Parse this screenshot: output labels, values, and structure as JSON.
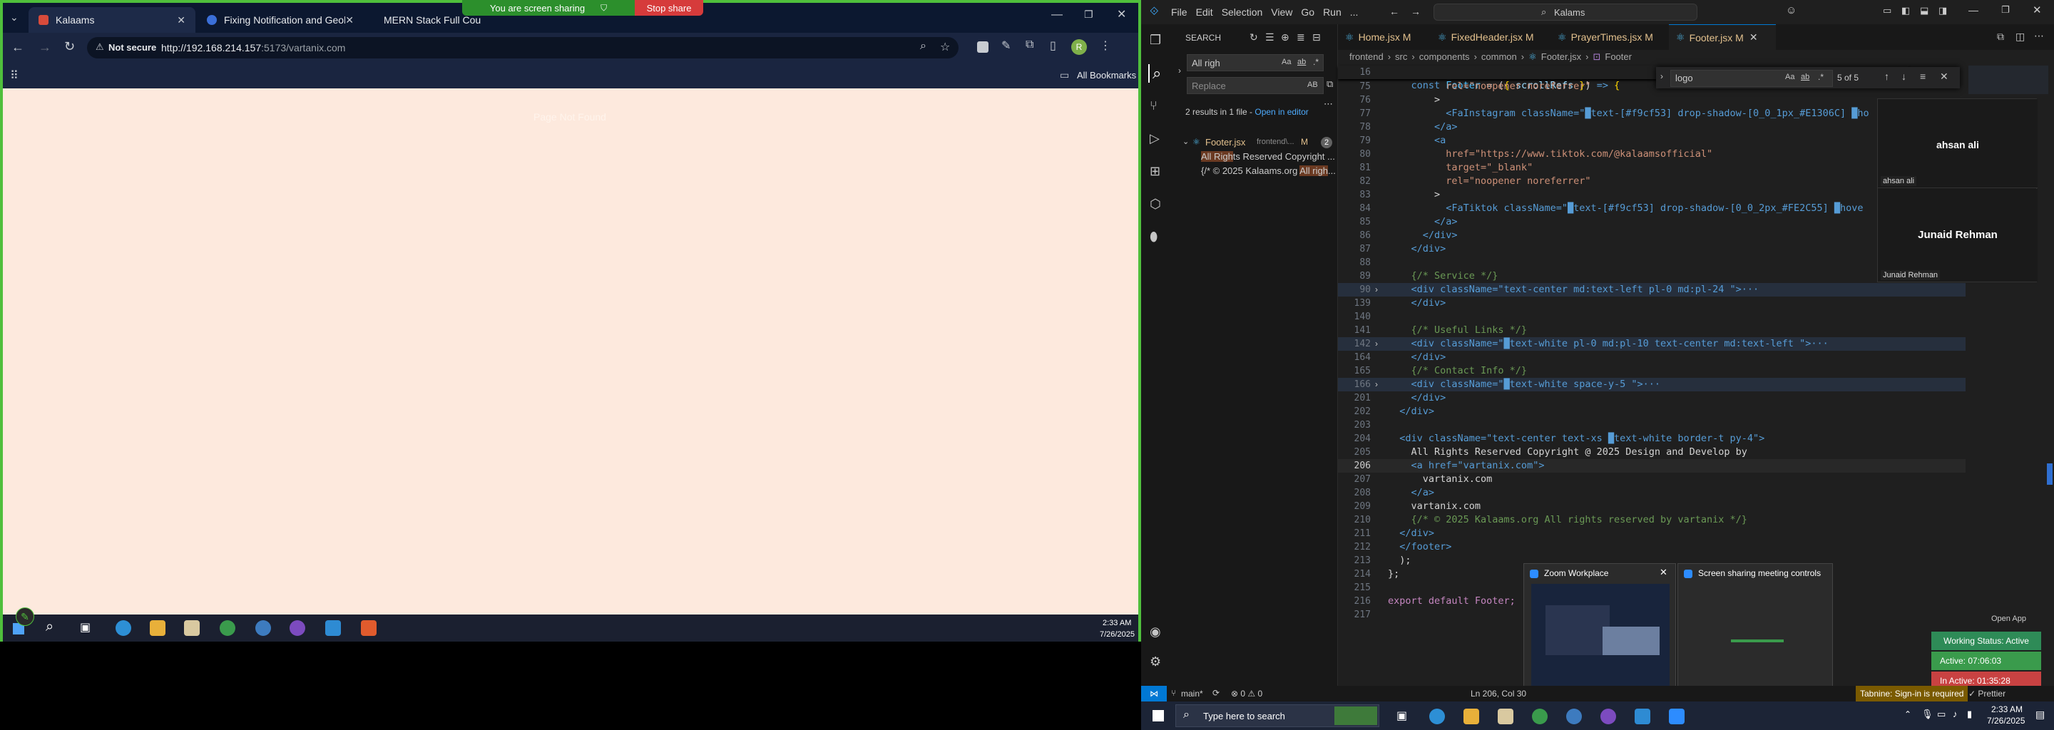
{
  "share": {
    "banner_text": "You are screen sharing",
    "stop_label": "Stop share"
  },
  "browser": {
    "tabs": [
      {
        "label": "Kalaams",
        "color": "#d84b3b"
      },
      {
        "label": "Fixing Notification and Geoloca",
        "color": "#3b6fd8"
      },
      {
        "label": "MERN Stack Full Cou",
        "color": "#d8243b"
      }
    ],
    "security_label": "Not secure",
    "url_host": "http://192.168.214.157",
    "url_path": ":5173/vartanix.com",
    "bookmarks_label": "All Bookmarks",
    "profile_initial": "R",
    "page_ghost_text": "Page Not Found"
  },
  "left_taskbar": {
    "time": "2:33 AM",
    "date": "7/26/2025"
  },
  "vscode": {
    "title": "Kalams",
    "menu": [
      "File",
      "Edit",
      "Selection",
      "View",
      "Go",
      "Run",
      "..."
    ],
    "search": {
      "header": "SEARCH",
      "query": "All righ",
      "replace_placeholder": "Replace",
      "results_summary": "2 results in 1 file - ",
      "open_in_editor": "Open in editor",
      "file_name": "Footer.jsx",
      "file_path": "frontend\\...",
      "file_badge": "M",
      "file_count": "2",
      "results": [
        {
          "pre": "",
          "match": "All Righ",
          "post": "ts Reserved Copyright ..."
        },
        {
          "pre": "{/* © 2025 Kalaams.org ",
          "match": "All righ",
          "post": "..."
        }
      ]
    },
    "tabs": [
      {
        "label": "Home.jsx M",
        "active": false
      },
      {
        "label": "FixedHeader.jsx M",
        "active": false
      },
      {
        "label": "PrayerTimes.jsx M",
        "active": false
      },
      {
        "label": "Footer.jsx M",
        "active": true
      }
    ],
    "breadcrumb": [
      "frontend",
      "src",
      "components",
      "common",
      "Footer.jsx",
      "Footer"
    ],
    "sticky_line": {
      "num": "16",
      "text": "const Footer = ({ scrollRefs }) => {"
    },
    "find_widget": {
      "query": "logo",
      "count": "5 of 5"
    },
    "lines": [
      {
        "num": "75",
        "text": "          rel=\"noopener noreferrer\""
      },
      {
        "num": "76",
        "text": "        >"
      },
      {
        "num": "77",
        "text": "          <FaInstagram className=\"█text-[#f9cf53] drop-shadow-[0_0_1px_#E1306C] █ho"
      },
      {
        "num": "78",
        "text": "        </a>"
      },
      {
        "num": "79",
        "text": "        <a"
      },
      {
        "num": "80",
        "text": "          href=\"https://www.tiktok.com/@kalaamsofficial\""
      },
      {
        "num": "81",
        "text": "          target=\"_blank\""
      },
      {
        "num": "82",
        "text": "          rel=\"noopener noreferrer\""
      },
      {
        "num": "83",
        "text": "        >"
      },
      {
        "num": "84",
        "text": "          <FaTiktok className=\"█text-[#f9cf53] drop-shadow-[0_0_2px_#FE2C55] █hove"
      },
      {
        "num": "85",
        "text": "        </a>"
      },
      {
        "num": "86",
        "text": "      </div>"
      },
      {
        "num": "87",
        "text": "    </div>"
      },
      {
        "num": "88",
        "text": ""
      },
      {
        "num": "89",
        "text": "    {/* Service */}"
      },
      {
        "num": "90",
        "text": "    <div className=\"text-center md:text-left pl-0 md:pl-24 \">···"
      },
      {
        "num": "139",
        "text": "    </div>"
      },
      {
        "num": "140",
        "text": ""
      },
      {
        "num": "141",
        "text": "    {/* Useful Links */}"
      },
      {
        "num": "142",
        "text": "    <div className=\"█text-white pl-0 md:pl-10 text-center md:text-left \">···"
      },
      {
        "num": "164",
        "text": "    </div>"
      },
      {
        "num": "165",
        "text": "    {/* Contact Info */}"
      },
      {
        "num": "166",
        "text": "    <div className=\"█text-white space-y-5 \">···"
      },
      {
        "num": "201",
        "text": "    </div>"
      },
      {
        "num": "202",
        "text": "  </div>"
      },
      {
        "num": "203",
        "text": ""
      },
      {
        "num": "204",
        "text": "  <div className=\"text-center text-xs █text-white border-t py-4\">"
      },
      {
        "num": "205",
        "text": "    All Rights Reserved Copyright @ 2025 Design and Develop by"
      },
      {
        "num": "206",
        "text": "    <a href=\"vartanix.com\">"
      },
      {
        "num": "207",
        "text": "      vartanix.com"
      },
      {
        "num": "208",
        "text": "    </a>"
      },
      {
        "num": "209",
        "text": "    vartanix.com"
      },
      {
        "num": "210",
        "text": "    {/* © 2025 Kalaams.org All rights reserved by vartanix */}"
      },
      {
        "num": "211",
        "text": "  </div>"
      },
      {
        "num": "212",
        "text": "  </footer>"
      },
      {
        "num": "213",
        "text": "  );"
      },
      {
        "num": "214",
        "text": "};"
      },
      {
        "num": "215",
        "text": ""
      },
      {
        "num": "216",
        "text": "export default Footer;"
      },
      {
        "num": "217",
        "text": ""
      }
    ],
    "status": {
      "branch": "main*",
      "problems": "0 ⚠ 0",
      "position": "Ln 206, Col 30",
      "tabnine": "Tabnine: Sign-in is required",
      "prettier": "Prettier"
    }
  },
  "zoom_gallery": {
    "participants": [
      {
        "display": "ahsan ali",
        "label": "ahsan ali"
      },
      {
        "display": "Junaid Rehman",
        "label": "Junaid Rehman"
      }
    ]
  },
  "popups": {
    "zoom_workplace": "Zoom Workplace",
    "meeting_controls": "Screen sharing meeting controls"
  },
  "tracker": {
    "open_app": "Open App",
    "working_status": "Working Status: Active",
    "active_time": "Active: 07:06:03",
    "inactive_time": "In Active: 01:35:28"
  },
  "win_taskbar": {
    "search_placeholder": "Type here to search",
    "time": "2:33 AM",
    "date": "7/26/2025"
  }
}
